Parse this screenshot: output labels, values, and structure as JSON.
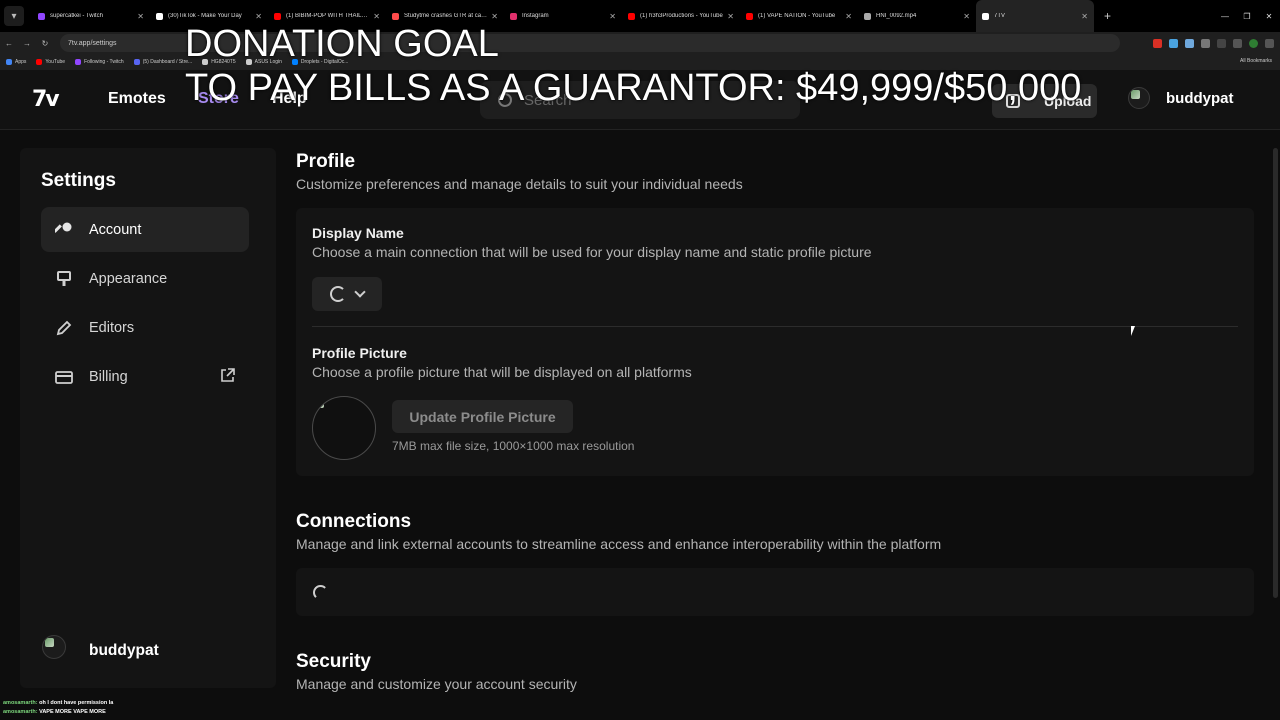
{
  "browser": {
    "tabs": [
      {
        "title": "supercatkei - Twitch",
        "color": "#9146ff"
      },
      {
        "title": "(30)TikTok - Make Your Day",
        "color": "#ffffff"
      },
      {
        "title": "(1) BIBIM-POP WITH THAILAND",
        "color": "#ff0000"
      },
      {
        "title": "Studytme crashes GTR at car m",
        "color": "#ff4b4b"
      },
      {
        "title": "Instagram",
        "color": "#e1306c"
      },
      {
        "title": "(1) h3h3Productions - YouTube",
        "color": "#ff0000"
      },
      {
        "title": "(1) VAPE NATION - YouTube",
        "color": "#ff0000"
      },
      {
        "title": "HNI_0092.mp4",
        "color": "#aaaaaa"
      },
      {
        "title": "7TV",
        "color": "#ffffff"
      }
    ],
    "url": "7tv.app/settings",
    "bookmarks": [
      {
        "label": "Apps",
        "color": "#4285f4"
      },
      {
        "label": "YouTube",
        "color": "#ff0000"
      },
      {
        "label": "Following - Twitch",
        "color": "#9146ff"
      },
      {
        "label": "(5) Dashboard / Stre...",
        "color": "#5865f2"
      },
      {
        "label": "HG8240T5",
        "color": "#cccccc"
      },
      {
        "label": "ASUS Login",
        "color": "#cccccc"
      },
      {
        "label": "Droplets - DigitalOc...",
        "color": "#0080ff"
      }
    ],
    "all_bookmarks_label": "All Bookmarks"
  },
  "overlay": {
    "line1": "DONATION GOAL",
    "line2": "TO PAY BILLS AS A GUARANTOR: $49,999/$50,000"
  },
  "nav": {
    "logo": "7v",
    "emotes": "Emotes",
    "store": "Store",
    "help": "Help",
    "search_placeholder": "Search",
    "upload": "Upload",
    "username": "buddypat"
  },
  "sidebar": {
    "title": "Settings",
    "items": [
      {
        "label": "Account",
        "icon": "key-icon"
      },
      {
        "label": "Appearance",
        "icon": "brush-icon"
      },
      {
        "label": "Editors",
        "icon": "pencil-icon"
      },
      {
        "label": "Billing",
        "icon": "card-icon"
      }
    ],
    "username": "buddypat"
  },
  "profile": {
    "title": "Profile",
    "desc": "Customize preferences and manage details to suit your individual needs",
    "display_name_label": "Display Name",
    "display_name_desc": "Choose a main connection that will be used for your display name and static profile picture",
    "pfp_label": "Profile Picture",
    "pfp_desc": "Choose a profile picture that will be displayed on all platforms",
    "update_button": "Update Profile Picture",
    "hint": "7MB max file size, 1000×1000 max resolution"
  },
  "connections": {
    "title": "Connections",
    "desc": "Manage and link external accounts to streamline access and enhance interoperability within the platform"
  },
  "security": {
    "title": "Security",
    "desc": "Manage and customize your account security"
  },
  "chat": [
    {
      "user": "amosamarth:",
      "msg": "oh I dont have permission la"
    },
    {
      "user": "amosamarth:",
      "msg": "VAPE MORE VAPE MORE"
    }
  ],
  "colors": {
    "accent": "#a98cf2",
    "background": "#0d0d0d",
    "card": "#141414"
  }
}
